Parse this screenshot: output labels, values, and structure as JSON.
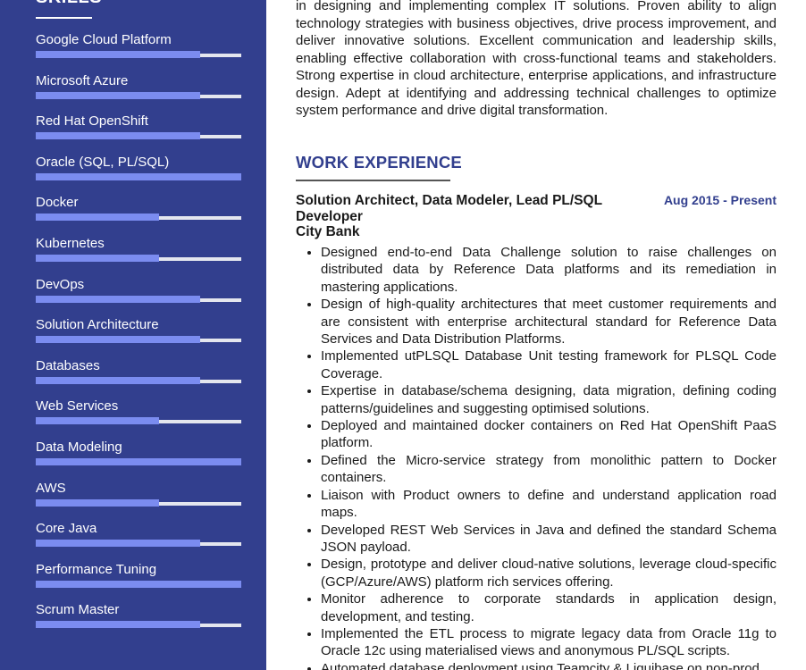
{
  "sidebar": {
    "heading": "SKILLS",
    "skills": [
      {
        "label": "Google Cloud Platform",
        "level": 0.8
      },
      {
        "label": "Microsoft Azure",
        "level": 0.8
      },
      {
        "label": "Red Hat OpenShift",
        "level": 0.8
      },
      {
        "label": "Oracle (SQL, PL/SQL)",
        "level": 1.0
      },
      {
        "label": "Docker",
        "level": 0.6
      },
      {
        "label": "Kubernetes",
        "level": 0.6
      },
      {
        "label": "DevOps",
        "level": 0.8
      },
      {
        "label": "Solution Architecture",
        "level": 0.8
      },
      {
        "label": "Databases",
        "level": 0.8
      },
      {
        "label": "Web Services",
        "level": 0.6
      },
      {
        "label": "Data Modeling",
        "level": 1.0
      },
      {
        "label": "AWS",
        "level": 0.6
      },
      {
        "label": "Core Java",
        "level": 0.8
      },
      {
        "label": "Performance Tuning",
        "level": 1.0
      },
      {
        "label": "Scrum Master",
        "level": 0.8
      }
    ]
  },
  "main": {
    "summary": "in designing and implementing complex IT solutions. Proven ability to align technology strategies with business objectives, drive process improvement, and deliver innovative solutions. Excellent communication and leadership skills, enabling effective collaboration with cross-functional teams and stakeholders. Strong expertise in cloud architecture, enterprise applications, and infrastructure design. Adept at identifying and addressing technical challenges to optimize system performance and drive digital transformation.",
    "work_heading": "WORK EXPERIENCE",
    "job": {
      "title": "Solution Architect, Data Modeler, Lead PL/SQL Developer",
      "date": "Aug 2015 - Present",
      "company": "City Bank",
      "bullets": [
        "Designed end-to-end Data Challenge solution to raise challenges on distributed data by Reference Data platforms and its remediation in mastering applications.",
        "Design of high-quality architectures that meet customer requirements and are consistent with enterprise architectural standard for Reference Data Services and Data Distribution Platforms.",
        "Implemented utPLSQL Database Unit testing framework for PLSQL Code Coverage.",
        "Expertise in database/schema designing, data migration, defining coding patterns/guidelines and suggesting optimised solutions.",
        "Deployed and maintained docker containers on Red Hat OpenShift PaaS platform.",
        "Defined the Micro-service strategy from monolithic pattern to Docker containers.",
        "Liaison with Product owners to define and understand application road maps.",
        "Developed REST Web Services in Java and defined the standard Schema JSON payload.",
        "Design, prototype and deliver cloud-native solutions, leverage cloud-specific (GCP/Azure/AWS) platform rich services offering.",
        "Monitor adherence to corporate standards in application design, development, and testing.",
        "Implemented the ETL process to migrate legacy data from Oracle 11g to Oracle 12c using materialised views and anonymous PL/SQL scripts.",
        "Automated database deployment using Teamcity & Liquibase on non-prod"
      ]
    }
  },
  "colors": {
    "sidebar": "#323f8e",
    "bar_fill": "#7b8cf0",
    "bar_track": "#e4e6ee",
    "accent": "#323f8e"
  }
}
